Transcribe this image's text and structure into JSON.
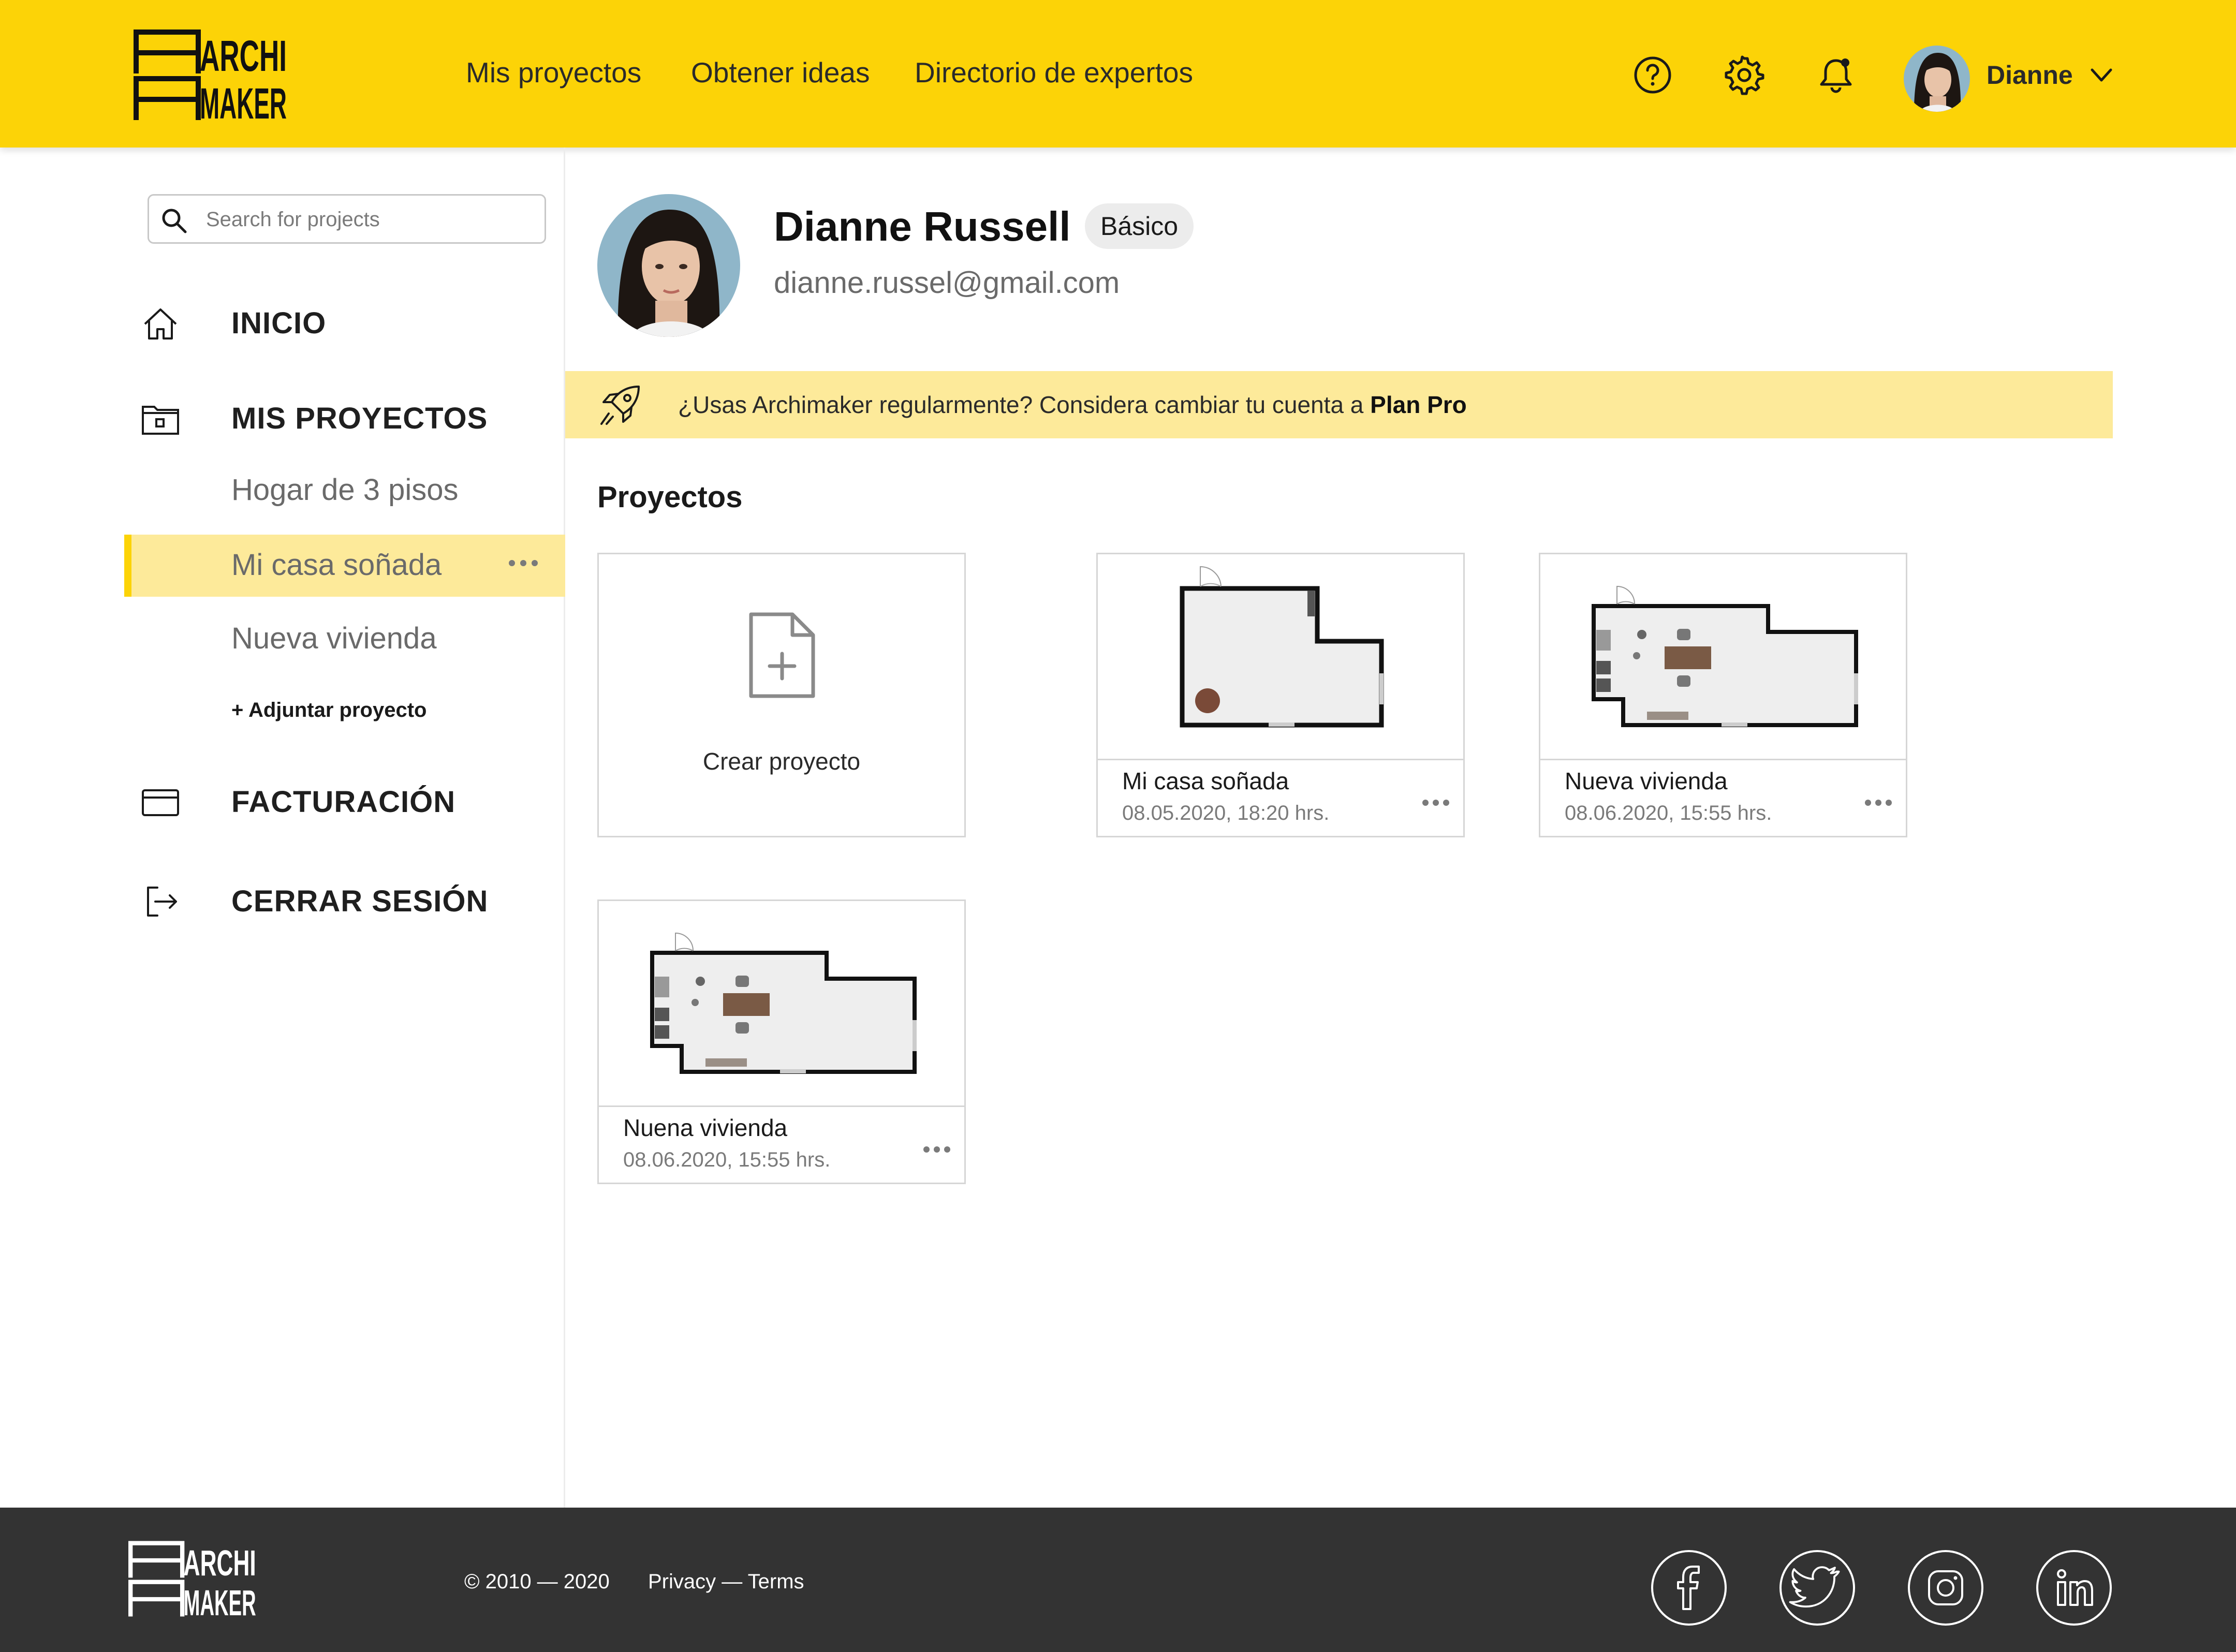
{
  "brand": {
    "logo_line1": "ARCHI",
    "logo_line2": "MAKER"
  },
  "nav": {
    "items": [
      "Mis proyectos",
      "Obtener ideas",
      "Directorio de expertos"
    ]
  },
  "header": {
    "icons": [
      "help-icon",
      "settings-icon",
      "notification-bell-icon"
    ],
    "user_name": "Dianne"
  },
  "sidebar": {
    "search_placeholder": "Search for projects",
    "inicio": "INICIO",
    "mis_proyectos": "MIS PROYECTOS",
    "projects": [
      "Hogar de 3 pisos",
      "Mi casa soñada",
      "Nueva vivienda"
    ],
    "active_project": "Mi casa soñada",
    "attach": "+ Adjuntar proyecto",
    "facturacion": "FACTURACIÓN",
    "cerrar_sesion": "CERRAR SESIÓN"
  },
  "profile": {
    "name": "Dianne Russell",
    "plan": "Básico",
    "email": "dianne.russel@gmail.com"
  },
  "banner": {
    "text": "¿Usas Archimaker regularmente? Considera cambiar tu cuenta a ",
    "highlight": "Plan Pro"
  },
  "projects_section": {
    "title": "Proyectos",
    "create_label": "Crear proyecto",
    "cards": [
      {
        "title": "Mi casa soñada",
        "date": "08.05.2020, 18:20 hrs."
      },
      {
        "title": "Nueva vivienda",
        "date": "08.06.2020, 15:55 hrs."
      },
      {
        "title": "Nuena vivienda",
        "date": "08.06.2020, 15:55 hrs."
      }
    ]
  },
  "footer": {
    "copyright": "© 2010 — 2020",
    "legal": "Privacy — Terms",
    "social": [
      "facebook-icon",
      "twitter-icon",
      "instagram-icon",
      "linkedin-icon"
    ]
  },
  "colors": {
    "accent": "#FCD307",
    "accent_light": "#FDEA9A",
    "footer_bg": "#333333"
  }
}
